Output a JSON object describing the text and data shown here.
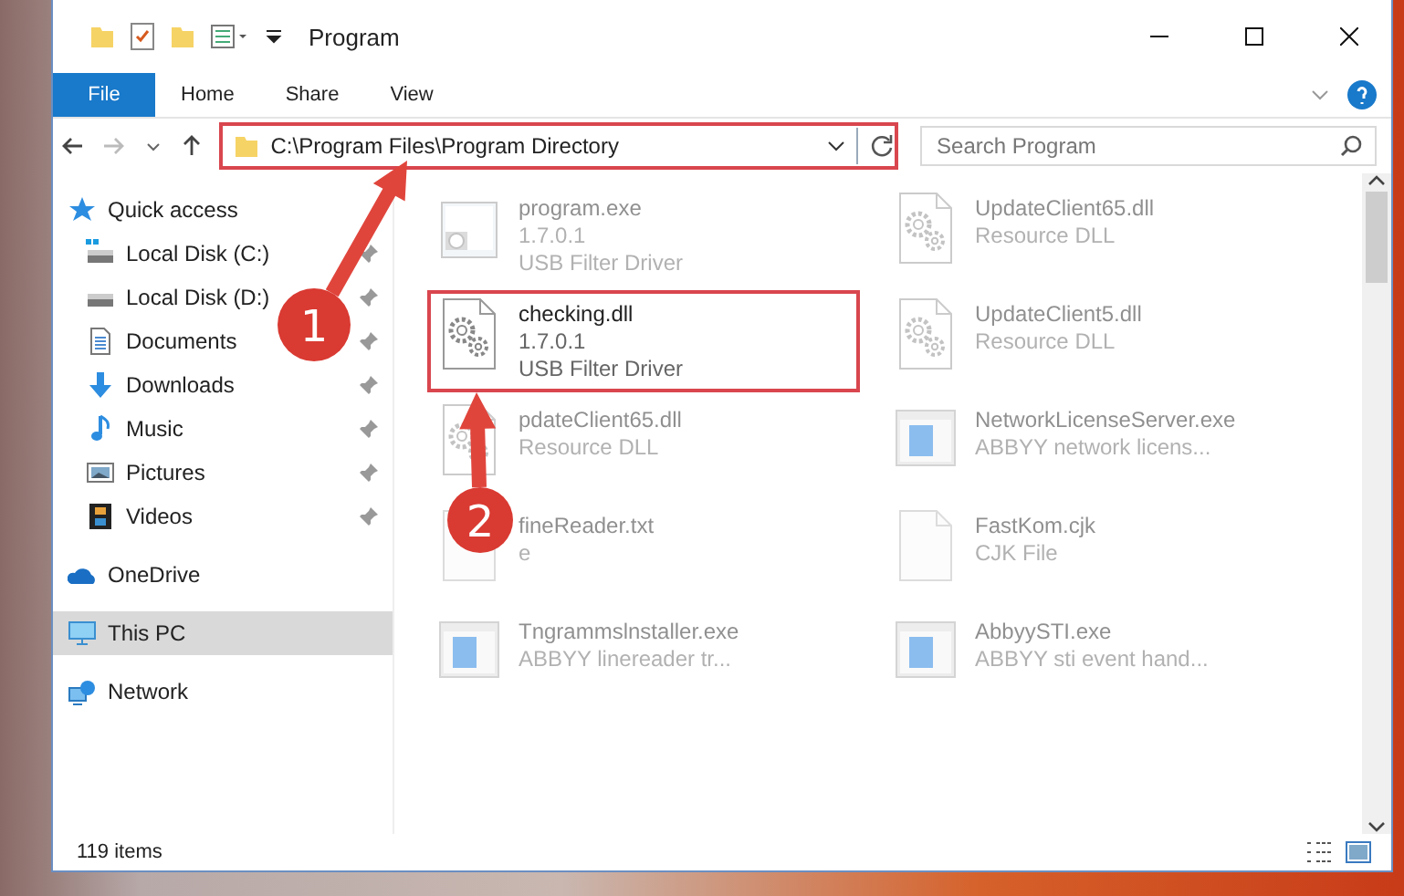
{
  "window": {
    "title": "Program"
  },
  "tabs": [
    {
      "label": "File",
      "kind": "file"
    },
    {
      "label": "Home",
      "kind": "tab"
    },
    {
      "label": "Share",
      "kind": "tab"
    },
    {
      "label": "View",
      "kind": "tab"
    }
  ],
  "address_bar": {
    "path": "C:\\Program Files\\Program Directory",
    "highlighted": true
  },
  "search": {
    "placeholder": "Search Program"
  },
  "sidebar": {
    "items": [
      {
        "label": "Quick access",
        "kind": "star",
        "selected": false,
        "children": [
          {
            "label": "Local Disk (C:)",
            "kind": "system-disk",
            "pinned": true,
            "selected": false
          },
          {
            "label": "Local Disk (D:)",
            "kind": "disk",
            "pinned": true,
            "selected": false
          },
          {
            "label": "Documents",
            "kind": "documents",
            "pinned": true,
            "selected": false
          },
          {
            "label": "Downloads",
            "kind": "downloads",
            "pinned": true,
            "selected": false
          },
          {
            "label": "Music",
            "kind": "music",
            "pinned": true,
            "selected": false
          },
          {
            "label": "Pictures",
            "kind": "pictures",
            "pinned": true,
            "selected": false
          },
          {
            "label": "Videos",
            "kind": "videos",
            "pinned": true,
            "selected": false
          }
        ]
      },
      {
        "label": "OneDrive",
        "kind": "cloud",
        "selected": false
      },
      {
        "label": "This PC",
        "kind": "computer",
        "selected": true
      },
      {
        "label": "Network",
        "kind": "network",
        "selected": false
      }
    ]
  },
  "files": [
    {
      "name": "program.exe",
      "details": [
        "1.7.0.1",
        "USB Filter Driver"
      ],
      "kind": "exe",
      "faded": true,
      "highlighted": false
    },
    {
      "name": "UpdateClient65.dll",
      "details": [
        "Resource DLL"
      ],
      "kind": "dll",
      "faded": true,
      "highlighted": false
    },
    {
      "name": "checking.dll",
      "details": [
        "1.7.0.1",
        "USB Filter Driver"
      ],
      "kind": "dll",
      "faded": false,
      "highlighted": true
    },
    {
      "name": "UpdateClient5.dll",
      "details": [
        "Resource DLL"
      ],
      "kind": "dll",
      "faded": true,
      "highlighted": false
    },
    {
      "name": "pdateClient65.dll",
      "details": [
        "Resource DLL"
      ],
      "kind": "dll",
      "faded": true,
      "highlighted": false
    },
    {
      "name": "NetworkLicenseServer.exe",
      "details": [
        "ABBYY network licens..."
      ],
      "kind": "app",
      "faded": true,
      "highlighted": false
    },
    {
      "name": "fineReader.txt",
      "details": [
        "e"
      ],
      "kind": "blank",
      "faded": true,
      "highlighted": false
    },
    {
      "name": "FastKom.cjk",
      "details": [
        "CJK File"
      ],
      "kind": "blank",
      "faded": true,
      "highlighted": false
    },
    {
      "name": "Tngrammslnstaller.exe",
      "details": [
        "ABBYY linereader tr..."
      ],
      "kind": "app",
      "faded": true,
      "highlighted": false
    },
    {
      "name": "AbbyySTI.exe",
      "details": [
        "ABBYY sti event hand..."
      ],
      "kind": "app",
      "faded": true,
      "highlighted": false
    }
  ],
  "status_bar": {
    "item_count": "119 items"
  },
  "annotations": [
    {
      "number": "1"
    },
    {
      "number": "2"
    }
  ]
}
